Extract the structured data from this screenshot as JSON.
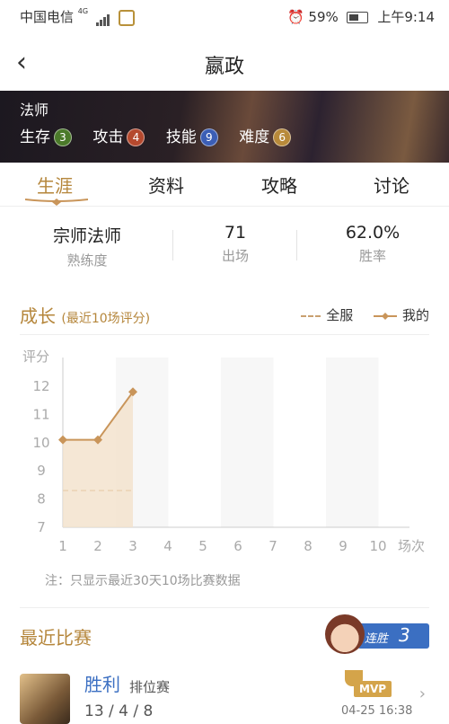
{
  "status_bar": {
    "carrier": "中国电信",
    "network": "4G",
    "battery": "59%",
    "time": "上午9:14"
  },
  "header": {
    "title": "嬴政"
  },
  "hero": {
    "role": "法师",
    "stats": [
      {
        "label": "生存",
        "value": "3",
        "color": "#4b7a2a"
      },
      {
        "label": "攻击",
        "value": "4",
        "color": "#b5492e"
      },
      {
        "label": "技能",
        "value": "9",
        "color": "#3b5eb5"
      },
      {
        "label": "难度",
        "value": "6",
        "color": "#b88a3a"
      }
    ]
  },
  "tabs": [
    {
      "label": "生涯",
      "active": true
    },
    {
      "label": "资料",
      "active": false
    },
    {
      "label": "攻略",
      "active": false
    },
    {
      "label": "讨论",
      "active": false
    }
  ],
  "summary": [
    {
      "value": "宗师法师",
      "label": "熟练度"
    },
    {
      "value": "71",
      "label": "出场"
    },
    {
      "value": "62.0%",
      "label": "胜率"
    }
  ],
  "growth": {
    "title": "成长",
    "subtitle": "(最近10场评分)",
    "legend_all": "全服",
    "legend_mine": "我的"
  },
  "chart_data": {
    "type": "line",
    "ylabel": "评分",
    "xlabel": "场次",
    "x": [
      1,
      2,
      3,
      4,
      5,
      6,
      7,
      8,
      9,
      10
    ],
    "ylim": [
      7,
      12
    ],
    "yticks": [
      7,
      8,
      9,
      10,
      11,
      12
    ],
    "series": [
      {
        "name": "全服",
        "style": "dashed",
        "x": [
          1,
          3
        ],
        "values": [
          8.3,
          8.3
        ]
      },
      {
        "name": "我的",
        "style": "solid-area",
        "x": [
          1,
          2,
          3
        ],
        "values": [
          10.1,
          10.1,
          11.8
        ]
      }
    ],
    "colors": {
      "line": "#c9955a",
      "area": "#f3e1cb",
      "band": "#f7f7f7"
    }
  },
  "note": "注：只显示最近30天10场比赛数据",
  "recent": {
    "title": "最近比赛",
    "streak_label": "连胜",
    "streak_count": "3"
  },
  "match": {
    "result": "胜利",
    "mode": "排位赛",
    "kda": "13 / 4 / 8",
    "badge": "MVP",
    "time": "04-25 16:38"
  }
}
